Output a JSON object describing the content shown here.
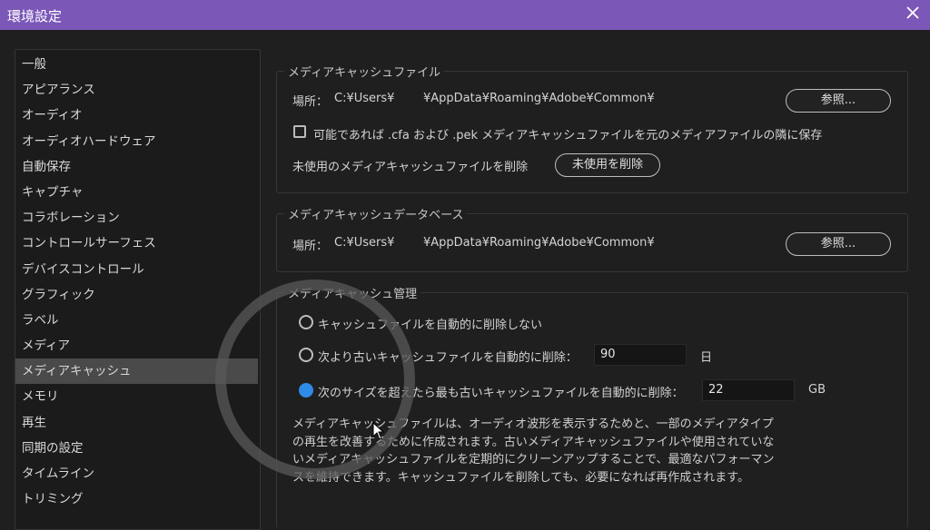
{
  "window": {
    "title": "環境設定"
  },
  "sidebar": {
    "items": [
      {
        "label": "一般"
      },
      {
        "label": "アピアランス"
      },
      {
        "label": "オーディオ"
      },
      {
        "label": "オーディオハードウェア"
      },
      {
        "label": "自動保存"
      },
      {
        "label": "キャプチャ"
      },
      {
        "label": "コラボレーション"
      },
      {
        "label": "コントロールサーフェス"
      },
      {
        "label": "デバイスコントロール"
      },
      {
        "label": "グラフィック"
      },
      {
        "label": "ラベル"
      },
      {
        "label": "メディア"
      },
      {
        "label": "メディアキャッシュ",
        "selected": true
      },
      {
        "label": "メモリ"
      },
      {
        "label": "再生"
      },
      {
        "label": "同期の設定"
      },
      {
        "label": "タイムライン"
      },
      {
        "label": "トリミング"
      }
    ]
  },
  "cache_files": {
    "legend": "メディアキャッシュファイル",
    "location_label": "場所：",
    "location_path_start": "C:¥Users¥",
    "location_path_end": "¥AppData¥Roaming¥Adobe¥Common¥",
    "browse_label": "参照...",
    "save_next_checkbox_label": "可能であれば .cfa および .pek メディアキャッシュファイルを元のメディアファイルの隣に保存",
    "save_next_checked": false,
    "delete_unused_label": "未使用のメディアキャッシュファイルを削除",
    "delete_unused_button": "未使用を削除"
  },
  "cache_database": {
    "legend": "メディアキャッシュデータベース",
    "location_label": "場所：",
    "location_path_start": "C:¥Users¥",
    "location_path_end": "¥AppData¥Roaming¥Adobe¥Common¥",
    "browse_label": "参照..."
  },
  "cache_management": {
    "legend": "メディアキャッシュ管理",
    "option_none": "キャッシュファイルを自動的に削除しない",
    "option_older": "次より古いキャッシュファイルを自動的に削除：",
    "older_value": "90",
    "older_unit": "日",
    "option_size": "次のサイズを超えたら最も古いキャッシュファイルを自動的に削除：",
    "size_value": "22",
    "size_unit": "GB",
    "selected_option": "size",
    "description": "メディアキャッシュファイルは、オーディオ波形を表示するためと、一部のメディアタイプの再生を改善するために作成されます。古いメディアキャッシュファイルや使用されていないメディアキャッシュファイルを定期的にクリーンアップすることで、最適なパフォーマンスを維持できます。キャッシュファイルを削除しても、必要になれば再作成されます。"
  },
  "colors": {
    "titlebar": "#7b57b8",
    "accent_radio": "#2e8be6",
    "background": "#1f1f1f"
  }
}
